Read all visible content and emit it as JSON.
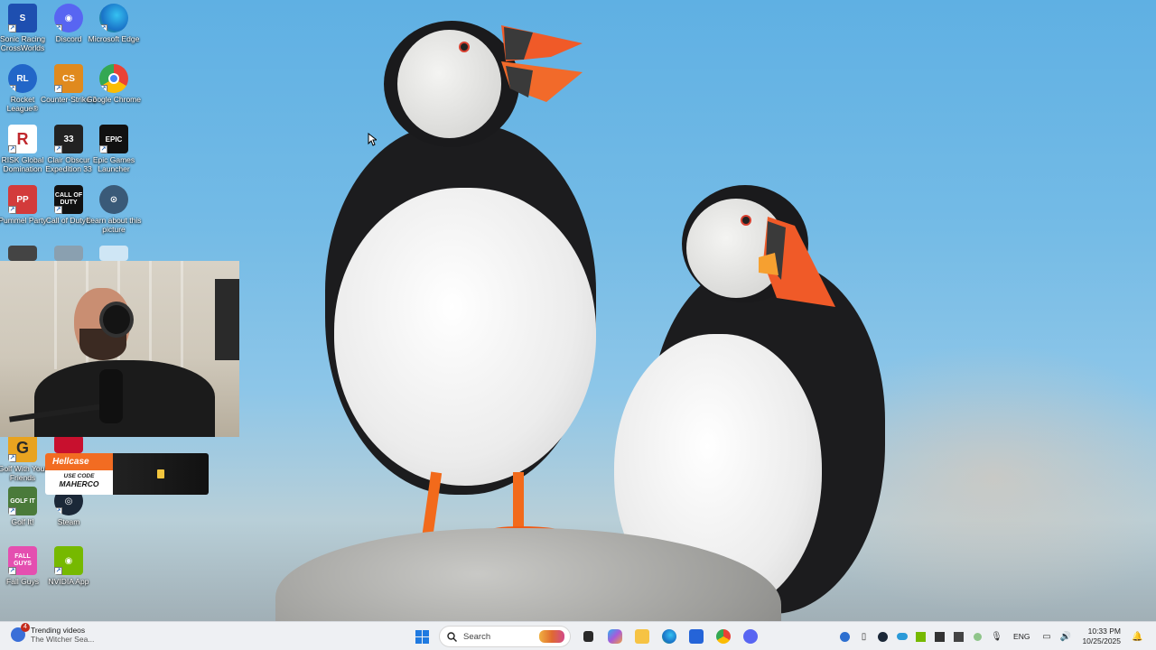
{
  "desktop": {
    "icons": [
      {
        "label": "Sonic Racing CrossWorlds",
        "icon": "sonic-icon",
        "color": "#1e4fb0"
      },
      {
        "label": "Discord",
        "icon": "discord-icon",
        "color": "#5865f2"
      },
      {
        "label": "Microsoft Edge",
        "icon": "edge-icon",
        "color": "#1aa0c8"
      },
      {
        "label": "Rocket League®",
        "icon": "rocket-league-icon",
        "color": "#2266c8"
      },
      {
        "label": "Counter-Strike 2",
        "icon": "counter-strike-icon",
        "color": "#e08a1e"
      },
      {
        "label": "Google Chrome",
        "icon": "chrome-icon",
        "color": "#e94235"
      },
      {
        "label": "RISK Global Domination",
        "icon": "risk-icon",
        "color": "#c0282d"
      },
      {
        "label": "Clair Obscur Expedition 33",
        "icon": "clair-obscur-icon",
        "color": "#222222"
      },
      {
        "label": "Epic Games Launcher",
        "icon": "epic-games-icon",
        "color": "#111111"
      },
      {
        "label": "Pummel Party",
        "icon": "pummel-party-icon",
        "color": "#d33b3b"
      },
      {
        "label": "Call of Duty®",
        "icon": "call-of-duty-icon",
        "color": "#111111"
      },
      {
        "label": "Learn about this picture",
        "icon": "learn-picture-icon",
        "color": "#3a5a78"
      },
      {
        "label": "Golf With Your Friends",
        "icon": "golf-with-friends-icon",
        "color": "#e8a320"
      },
      {
        "label": "Golf It!",
        "icon": "golf-it-icon",
        "color": "#4a7a3a"
      },
      {
        "label": "Steam",
        "icon": "steam-icon",
        "color": "#1b2838"
      },
      {
        "label": "Fall Guys",
        "icon": "fall-guys-icon",
        "color": "#e44fb0"
      },
      {
        "label": "NVIDIA App",
        "icon": "nvidia-icon",
        "color": "#76b900"
      }
    ]
  },
  "icon_text": {
    "epic": "EPIC",
    "cod": "CALL OF DUTY",
    "fall": "FALL GUYS"
  },
  "promo": {
    "brand": "Hellcase",
    "use_code": "USE CODE",
    "code": "MAHERCO"
  },
  "taskbar": {
    "widget_title": "Trending videos",
    "widget_subtitle": "The Witcher Sea...",
    "widget_badge": "4",
    "search_placeholder": "Search",
    "language": "ENG",
    "time": "10:33 PM",
    "date": "10/25/2025"
  },
  "colors": {
    "accent": "#1f7ae0",
    "taskbar_bg": "#eef0f3",
    "sky": "#6fb8e6",
    "puffin_beak": "#f05a28"
  }
}
